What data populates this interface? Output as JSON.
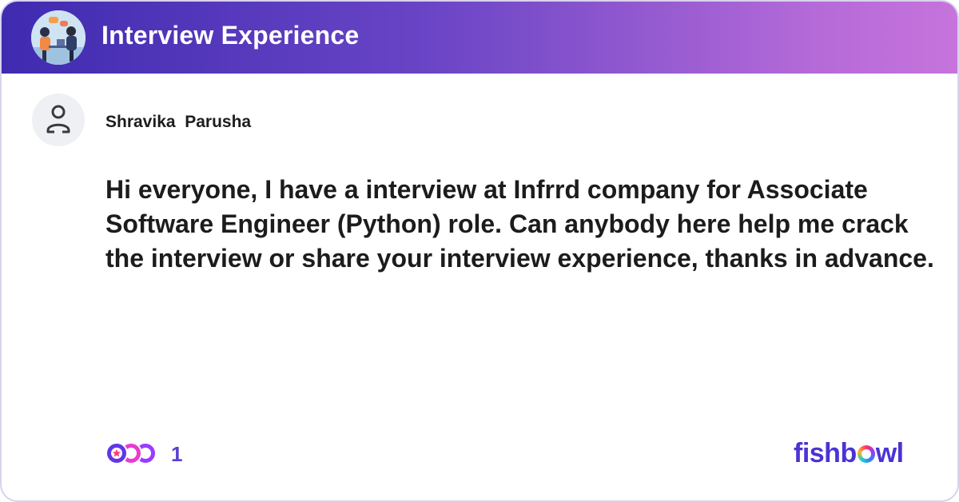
{
  "header": {
    "title": "Interview Experience"
  },
  "post": {
    "author": "Shravika  Parusha",
    "body": "Hi everyone, I have a interview at Infrrd company for Associate Software Engineer (Python) role. Can anybody here help me crack the interview or share your interview experience, thanks in advance."
  },
  "footer": {
    "reaction_count": "1",
    "brand_prefix": "fishb",
    "brand_suffix": "wl"
  },
  "colors": {
    "header_gradient_start": "#3f2bb0",
    "header_gradient_end": "#c774dc",
    "brand": "#4b33d3",
    "reaction_count": "#5b3fd0"
  },
  "icons": {
    "header_logo": "interview-illustration-icon",
    "avatar": "user-placeholder-icon",
    "reactions": "reaction-stack-icon"
  }
}
